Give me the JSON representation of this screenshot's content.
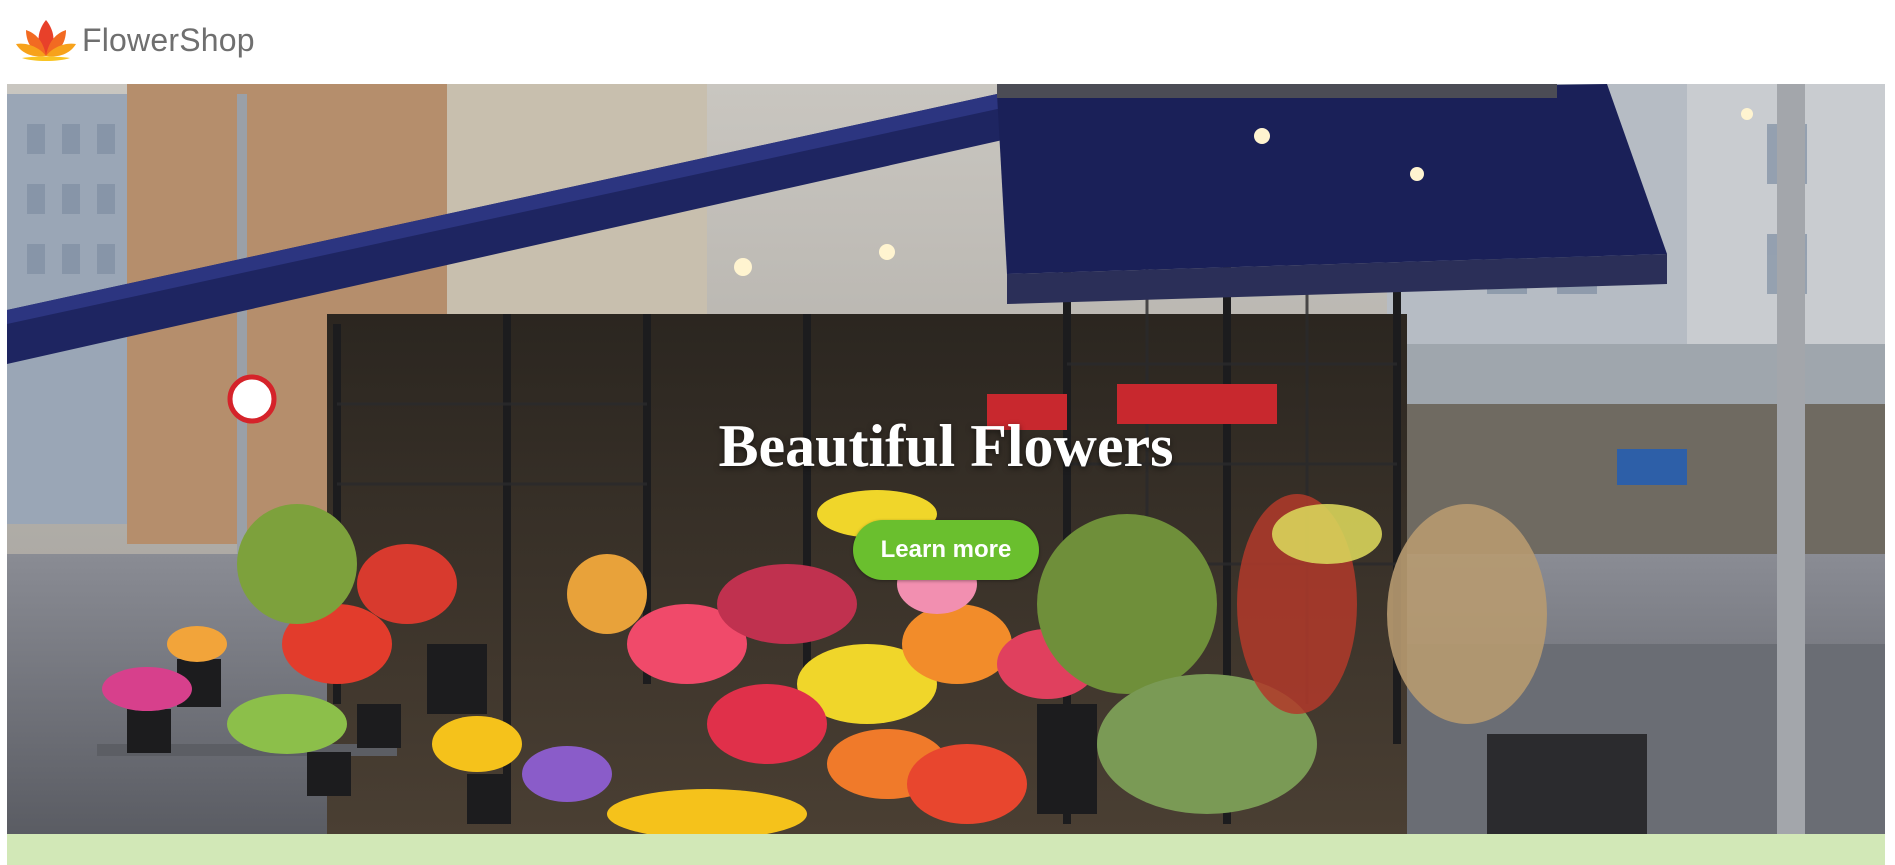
{
  "header": {
    "brand": "FlowerShop",
    "logo_icon": "lotus-flower-icon"
  },
  "hero": {
    "title": "Beautiful Flowers",
    "cta_label": "Learn more",
    "image_subject": "flower-stall-photo"
  },
  "colors": {
    "brand_text": "#6f6f6f",
    "cta_background": "#6abf2e",
    "footer_strip": "#d2e8b7",
    "awning": "#1e2561"
  }
}
